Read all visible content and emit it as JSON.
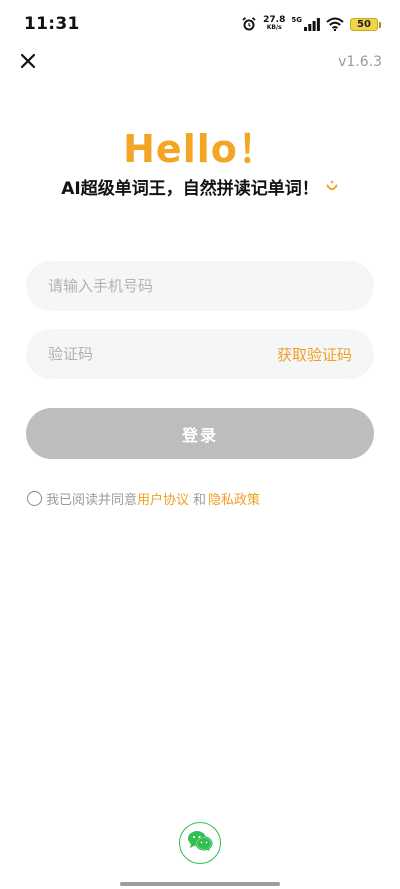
{
  "status_bar": {
    "time": "11:31",
    "net_speed_value": "27.8",
    "net_speed_unit": "KB/s",
    "network": "5G",
    "battery": "50"
  },
  "header": {
    "version": "v1.6.3"
  },
  "hero": {
    "title": "Hello！",
    "tagline": "AI超级单词王，自然拼读记单词！"
  },
  "form": {
    "phone_placeholder": "请输入手机号码",
    "code_placeholder": "验证码",
    "get_code_label": "获取验证码",
    "login_label": "登录"
  },
  "agreement": {
    "prefix": "我已阅读并同意",
    "user_agreement": "用户协议",
    "and": "和",
    "privacy_policy": "隐私政策"
  },
  "colors": {
    "accent": "#f5a524",
    "link": "#f0a020",
    "wechat": "#2fbf52",
    "button_disabled": "#bdbdbd"
  },
  "icons": {
    "close": "close-icon",
    "smile": "smile-icon",
    "wechat": "wechat-icon",
    "alarm": "alarm-icon",
    "wifi": "wifi-icon",
    "signal": "signal-icon"
  }
}
